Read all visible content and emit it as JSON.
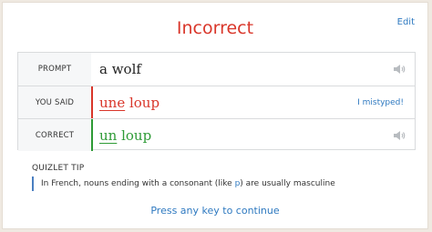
{
  "result": {
    "title": "Incorrect",
    "edit_label": "Edit"
  },
  "answer_table": {
    "prompt": {
      "label": "PROMPT",
      "text": "a wolf"
    },
    "you_said": {
      "label": "YOU SAID",
      "wrong_part": "une",
      "rest": " loup",
      "mistyped_label": "I mistyped!"
    },
    "correct": {
      "label": "CORRECT",
      "correct_part": "un",
      "rest": " loup"
    }
  },
  "tip": {
    "heading": "QUIZLET TIP",
    "text_before": "In French, nouns ending with a consonant (like ",
    "highlight": "p",
    "text_after": ") are usually masculine"
  },
  "continue_label": "Press any key to continue",
  "colors": {
    "incorrect": "#d9362a",
    "correct": "#2e9b36",
    "link": "#2e79c0"
  },
  "icons": {
    "audio": "speaker-icon"
  }
}
